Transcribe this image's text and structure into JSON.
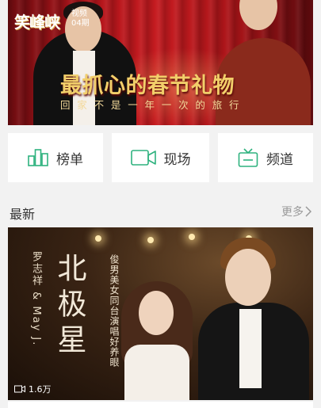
{
  "banner": {
    "logo_text": "笑峰峡",
    "logo_sub": "视频04期",
    "headline": "最抓心的春节礼物",
    "subline": "回家不是一年一次的旅行"
  },
  "nav_tiles": [
    {
      "label": "榜单",
      "icon": "bar-chart-icon"
    },
    {
      "label": "现场",
      "icon": "video-camera-icon"
    },
    {
      "label": "频道",
      "icon": "tv-icon"
    }
  ],
  "section": {
    "title": "最新",
    "more_label": "更多"
  },
  "featured": {
    "title": "北极星",
    "artist": "罗志祥 & May J.",
    "description": "俊男美女同台演唱好养眼",
    "views": "1.6万"
  },
  "colors": {
    "accent": "#2eb27e",
    "banner_red": "#c61b20"
  }
}
